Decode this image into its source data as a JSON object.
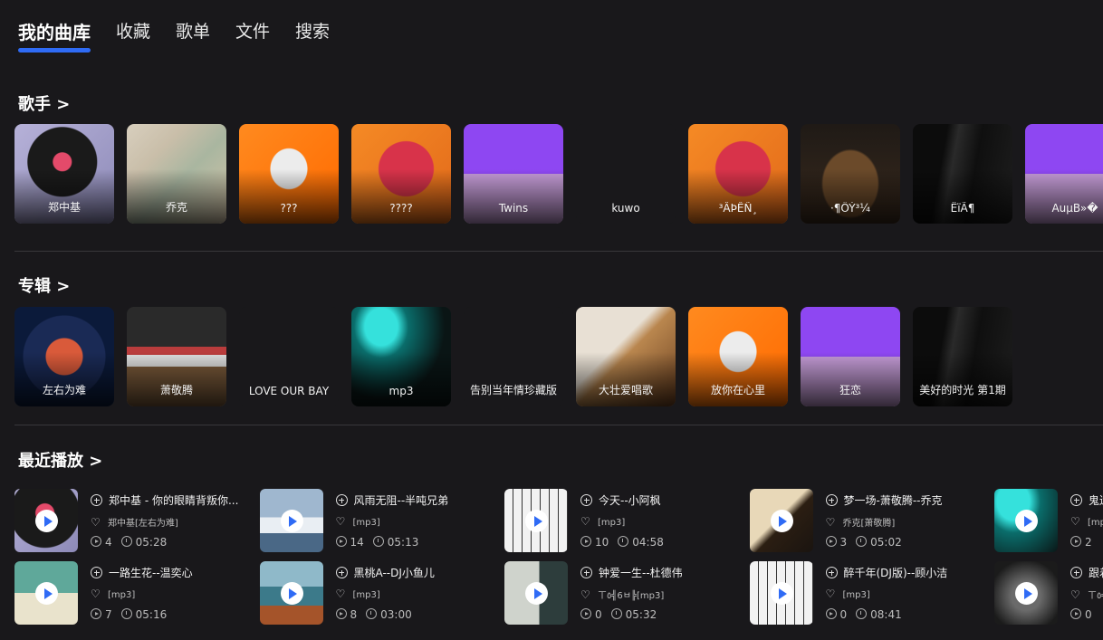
{
  "tabs": [
    {
      "label": "我的曲库",
      "active": true
    },
    {
      "label": "收藏",
      "active": false
    },
    {
      "label": "歌单",
      "active": false
    },
    {
      "label": "文件",
      "active": false
    },
    {
      "label": "搜索",
      "active": false
    }
  ],
  "accent_color": "#2f6bf5",
  "singers": {
    "title": "歌手 >",
    "items": [
      {
        "label": "郑中基",
        "art": "vinyl"
      },
      {
        "label": "乔克",
        "art": "map"
      },
      {
        "label": "???",
        "art": "cassette"
      },
      {
        "label": "????",
        "art": "hiphop"
      },
      {
        "label": "Twins",
        "art": "twins"
      },
      {
        "label": "kuwo",
        "art": "dark"
      },
      {
        "label": "³ÂÞÊÑ¸",
        "art": "hiphop"
      },
      {
        "label": "·¶ÔÝ³¼",
        "art": "concert"
      },
      {
        "label": "ËïÃ¶",
        "art": "guitar"
      },
      {
        "label": "AuµB»�",
        "art": "twins"
      }
    ]
  },
  "albums": {
    "title": "专辑 >",
    "items": [
      {
        "label": "左右为难",
        "art": "stones"
      },
      {
        "label": "萧敬腾",
        "art": "records"
      },
      {
        "label": "LOVE OUR BAY",
        "art": "dark"
      },
      {
        "label": "mp3",
        "art": "mic"
      },
      {
        "label": "告别当年情珍藏版",
        "art": "dark"
      },
      {
        "label": "大壮爱唱歌",
        "art": "violin"
      },
      {
        "label": "放你在心里",
        "art": "cassette"
      },
      {
        "label": "狂恋",
        "art": "twins"
      },
      {
        "label": "美好的时光 第1期",
        "art": "guitar"
      }
    ]
  },
  "recent": {
    "title": "最近播放 >",
    "songs": [
      {
        "title": "郑中基 - 你的眼睛背叛你...",
        "sub": "郑中基[左右为难]",
        "plays": "4",
        "duration": "05:28",
        "art": "vinyl"
      },
      {
        "title": "风雨无阻--半吨兄弟",
        "sub": "[mp3]",
        "plays": "14",
        "duration": "05:13",
        "art": "ice"
      },
      {
        "title": "今天--小阿枫",
        "sub": "[mp3]",
        "plays": "10",
        "duration": "04:58",
        "art": "piano"
      },
      {
        "title": "梦一场-萧敬腾--乔克",
        "sub": "乔克[萧敬腾]",
        "plays": "3",
        "duration": "05:02",
        "art": "sheet"
      },
      {
        "title": "鬼迷",
        "sub": "[mp",
        "plays": "2",
        "duration": "",
        "art": "mic"
      },
      {
        "title": "一路生花--温奕心",
        "sub": "[mp3]",
        "plays": "7",
        "duration": "05:16",
        "art": "boom"
      },
      {
        "title": "黑桃A--DJ小鱼儿",
        "sub": "[mp3]",
        "plays": "8",
        "duration": "03:00",
        "art": "canoe"
      },
      {
        "title": "钟爱一生--杜德伟",
        "sub": "ㄒ٥╣6ㅂ╠[mp3]",
        "plays": "0",
        "duration": "05:32",
        "art": "follow"
      },
      {
        "title": "醉千年(DJ版)--顾小洁",
        "sub": "[mp3]",
        "plays": "0",
        "duration": "08:41",
        "art": "piano"
      },
      {
        "title": "跟着",
        "sub": "ㄒ٥╣",
        "plays": "0",
        "duration": "",
        "art": "drums"
      }
    ]
  }
}
